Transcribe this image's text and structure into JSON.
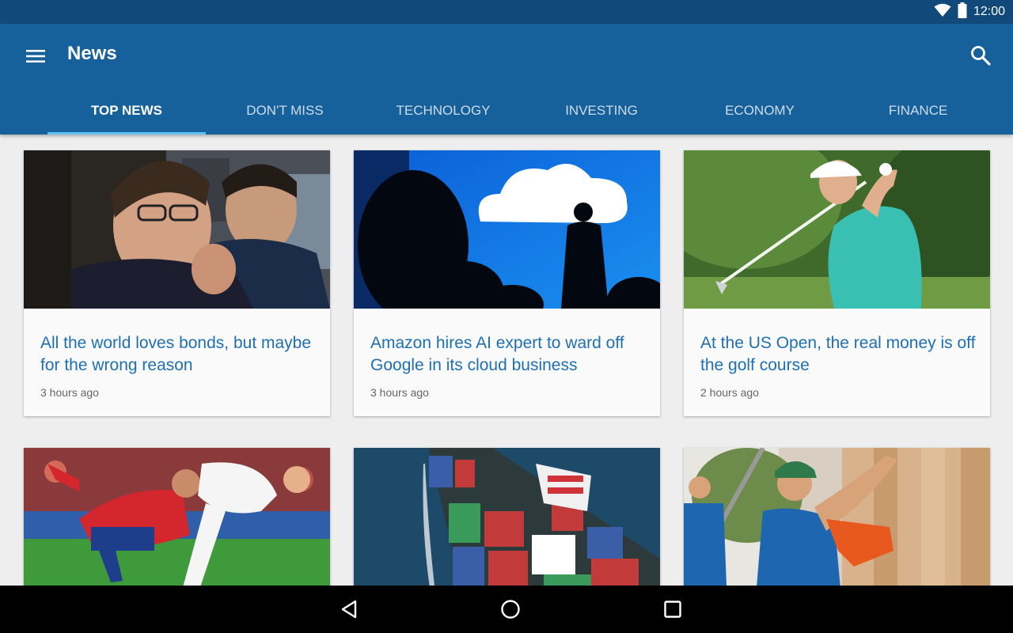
{
  "status_bar": {
    "time": "12:00"
  },
  "app_bar": {
    "title": "News"
  },
  "tabs": [
    {
      "label": "TOP NEWS"
    },
    {
      "label": "DON'T MISS"
    },
    {
      "label": "TECHNOLOGY"
    },
    {
      "label": "INVESTING"
    },
    {
      "label": "ECONOMY"
    },
    {
      "label": "FINANCE"
    }
  ],
  "articles": [
    {
      "title": "All the world loves bonds, but maybe for the wrong reason",
      "time": "3 hours ago"
    },
    {
      "title": "Amazon hires AI expert to ward off Google in its cloud business",
      "time": "3 hours ago"
    },
    {
      "title": "At the US Open, the real money is off the golf course",
      "time": "2 hours ago"
    },
    {
      "title": "",
      "time": ""
    },
    {
      "title": "",
      "time": ""
    },
    {
      "title": "",
      "time": ""
    }
  ],
  "colors": {
    "status_bar": "#114a7a",
    "app_bar": "#16609c",
    "tab_indicator": "#5ec2f2",
    "headline": "#1f6fb3"
  }
}
